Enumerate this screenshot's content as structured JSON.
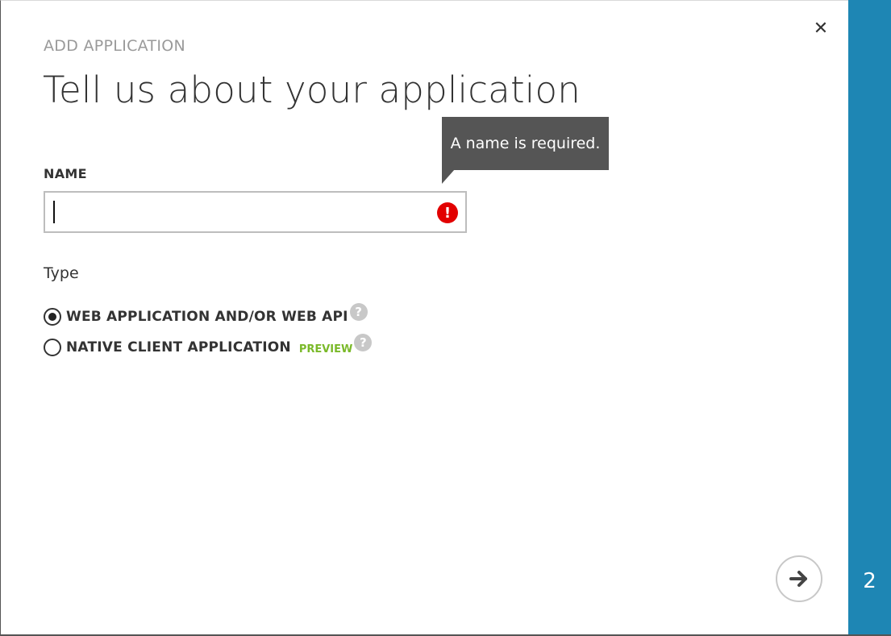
{
  "dialog": {
    "eyebrow": "ADD APPLICATION",
    "title": "Tell us about your application",
    "close_icon": "close-icon",
    "colors": {
      "accent": "#1e86b4",
      "error": "#e20000",
      "preview": "#7ab929",
      "tooltip_bg": "#555555"
    }
  },
  "name_field": {
    "label": "NAME",
    "value": "",
    "placeholder": "",
    "validation_message": "A name is required.",
    "error_icon": "exclamation-icon",
    "error_glyph": "!"
  },
  "type_section": {
    "label": "Type",
    "options": [
      {
        "label": "WEB APPLICATION AND/OR WEB API",
        "selected": true,
        "badge": ""
      },
      {
        "label": "NATIVE CLIENT APPLICATION",
        "selected": false,
        "badge": "PREVIEW"
      }
    ],
    "help_glyph": "?"
  },
  "navigation": {
    "next_icon": "arrow-right-icon",
    "step_number": "2"
  }
}
